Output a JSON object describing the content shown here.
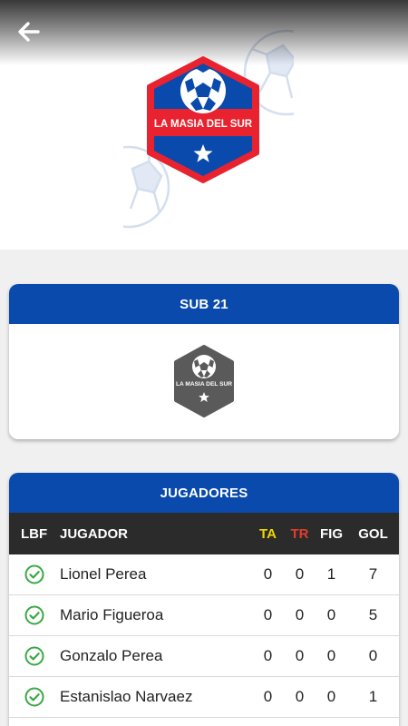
{
  "header": {
    "back_icon": "arrow-left-icon",
    "club_name": "LA MASIA DEL SUR"
  },
  "team_card": {
    "title": "SUB 21",
    "club_name": "LA MASIA DEL SUR"
  },
  "players_card": {
    "title": "JUGADORES",
    "columns": {
      "lbf": "LBF",
      "player": "JUGADOR",
      "ta": "TA",
      "tr": "TR",
      "fig": "FIG",
      "gol": "GOL"
    },
    "rows": [
      {
        "lbf_icon": "check-circle-icon",
        "name": "Lionel Perea",
        "ta": "0",
        "tr": "0",
        "fig": "1",
        "gol": "7"
      },
      {
        "lbf_icon": "check-circle-icon",
        "name": "Mario Figueroa",
        "ta": "0",
        "tr": "0",
        "fig": "0",
        "gol": "5"
      },
      {
        "lbf_icon": "check-circle-icon",
        "name": "Gonzalo Perea",
        "ta": "0",
        "tr": "0",
        "fig": "0",
        "gol": "0"
      },
      {
        "lbf_icon": "check-circle-icon",
        "name": "Estanislao Narvaez",
        "ta": "0",
        "tr": "0",
        "fig": "0",
        "gol": "1"
      }
    ]
  },
  "colors": {
    "primary_blue": "#0a4aad",
    "logo_red": "#e8232f",
    "ta_yellow": "#f2d600",
    "tr_red": "#e43b2c",
    "check_green": "#3aa845"
  }
}
